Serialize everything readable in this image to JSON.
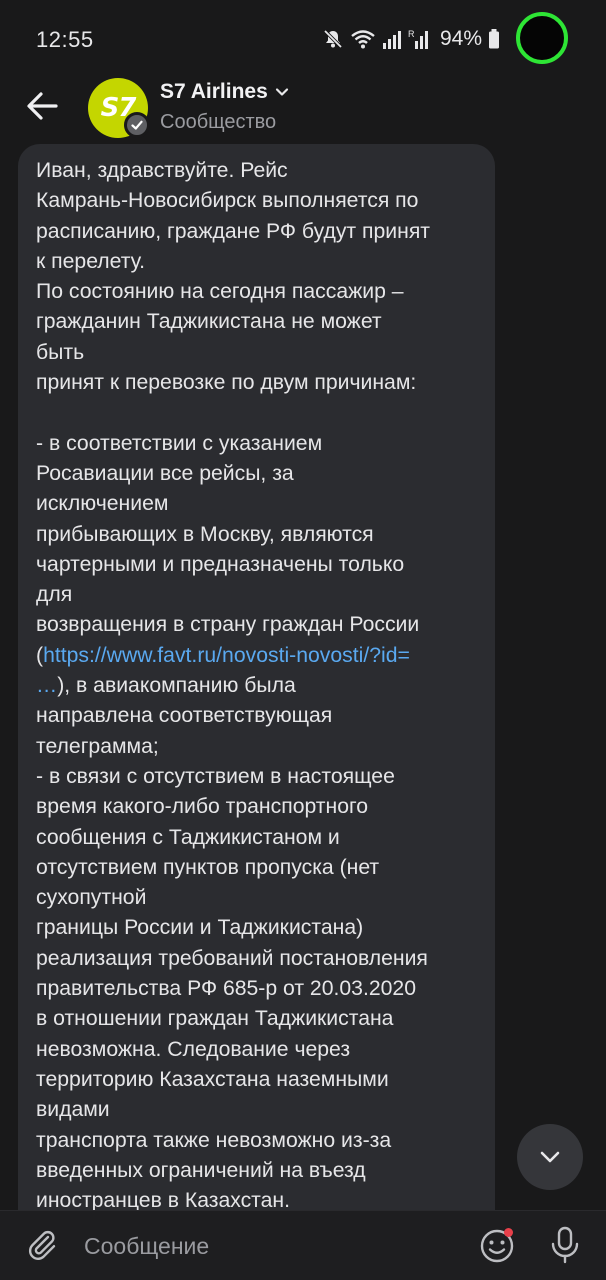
{
  "status_bar": {
    "time": "12:55",
    "battery_percent": "94%",
    "icons": [
      "mute-icon",
      "wifi-icon",
      "signal-icon",
      "signal-r-icon",
      "battery-icon"
    ],
    "record_color": "#2ee535"
  },
  "header": {
    "title": "S7 Airlines",
    "subtitle": "Сообщество",
    "avatar_text": "S7",
    "avatar_color": "#c4d600"
  },
  "message": {
    "lines": [
      "Иван, здравствуйте. Рейс",
      "Камрань-Новосибирск выполняется по",
      "расписанию, граждане РФ будут принят",
      "к перелету.",
      "По состоянию на сегодня пассажир –",
      "гражданин Таджикистана не может",
      "быть",
      "принят к перевозке по двум причинам:",
      "",
      "- в соответствии с указанием",
      "Росавиации все рейсы, за",
      "исключением",
      "прибывающих в Москву, являются",
      "чартерными и предназначены только",
      "для",
      "возвращения в страну граждан России",
      "(",
      "https://www.favt.ru/novosti-novosti/?id=",
      "…",
      "), в авиакомпанию была",
      "направлена соответствующая",
      "телеграмма;",
      "- в связи с отсутствием в настоящее",
      "время какого-либо транспортного",
      "сообщения с Таджикистаном и",
      "отсутствием пунктов пропуска (нет",
      "сухопутной",
      "границы России и Таджикистана)",
      "реализация требований постановления",
      "правительства РФ 685-р от 20.03.2020",
      "в отношении граждан Таджикистана",
      "невозможна. Следование через",
      "территорию Казахстана наземными",
      "видами",
      "транспорта также невозможно из-за",
      "введенных ограничений на въезд",
      "иностранцев в Казахстан."
    ]
  },
  "composer": {
    "placeholder": "Сообщение"
  },
  "colors": {
    "background": "#19191a",
    "bubble": "#2b2c30",
    "link": "#5aa9f0",
    "notification_dot": "#e8404a"
  }
}
